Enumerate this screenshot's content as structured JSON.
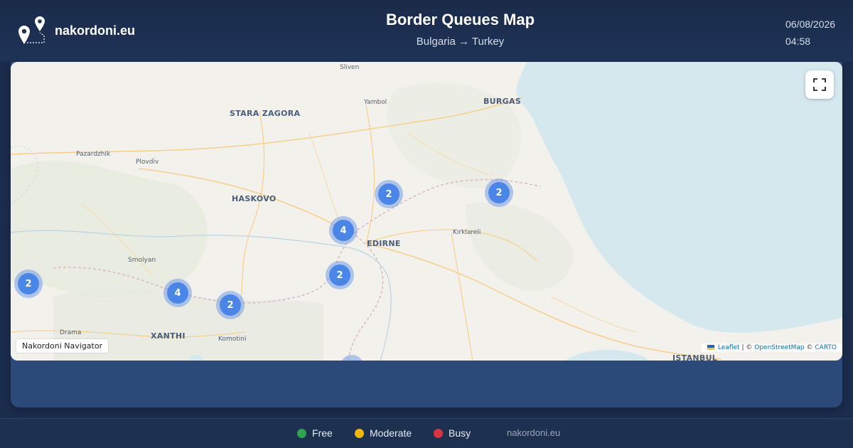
{
  "header": {
    "brand": "nakordoni.eu",
    "title": "Border Queues Map",
    "route": "Bulgaria → Turkey",
    "date": "06/08/2026",
    "time": "04:58",
    "logo_icon": "map-pins-route-icon"
  },
  "map": {
    "fullscreen_icon": "fullscreen-icon",
    "cluster_color": "#4a86e8",
    "clusters": [
      {
        "id": "c1",
        "count": "2"
      },
      {
        "id": "c2",
        "count": "2"
      },
      {
        "id": "c3",
        "count": "4"
      },
      {
        "id": "c4",
        "count": "2"
      },
      {
        "id": "c5",
        "count": "2"
      },
      {
        "id": "c6",
        "count": "4"
      },
      {
        "id": "c7",
        "count": "2"
      }
    ],
    "labels": {
      "sliven": "Sliven",
      "yambol": "Yambol",
      "burgas": "BURGAS",
      "stara_zagora": "STARA ZAGORA",
      "pazardzhik": "Pazardzhik",
      "plovdiv": "Plovdiv",
      "haskovo": "HASKOVO",
      "edirne": "EDIRNE",
      "kirklareli": "Kırklareli",
      "smolyan": "Smolyan",
      "drama": "Drama",
      "xanthi": "XANTHI",
      "komotini": "Komotini",
      "istanbul": "ISTANBUL"
    },
    "navigator_tag": "Nakordoni Navigator",
    "attribution": {
      "leaflet": "Leaflet",
      "sep1": "| ©",
      "osm": "OpenStreetMap",
      "sep2": "©",
      "carto": "CARTO"
    }
  },
  "footer": {
    "legend": [
      {
        "label": "Free",
        "color": "#2ea44f"
      },
      {
        "label": "Moderate",
        "color": "#f2b705"
      },
      {
        "label": "Busy",
        "color": "#d9343f"
      }
    ],
    "site": "nakordoni.eu"
  }
}
